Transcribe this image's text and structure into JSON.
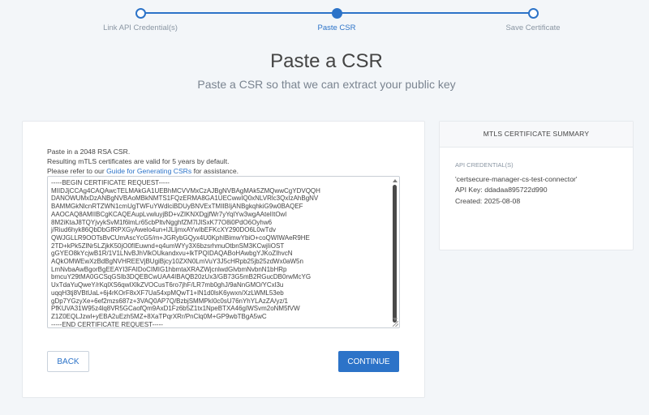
{
  "stepper": {
    "steps": [
      {
        "label": "Link API Credential(s)",
        "state": "complete"
      },
      {
        "label": "Paste CSR",
        "state": "active"
      },
      {
        "label": "Save Certificate",
        "state": "pending"
      }
    ]
  },
  "header": {
    "title": "Paste a CSR",
    "subtitle": "Paste a CSR so that we can extract your public key"
  },
  "form": {
    "line1": "Paste in a 2048 RSA CSR.",
    "line2": "Resulting mTLS certificates are valid for 5 years by default.",
    "line3_prefix": "Please refer to our ",
    "guide_link": "Guide for Generating CSRs",
    "line3_suffix": " for assistance.",
    "csr_value": "-----BEGIN CERTIFICATE REQUEST-----\nMIIDJjCCAg4CAQAwcTELMAkGA1UEBhMCVVMxCzAJBgNVBAgMAk5ZMQwwCgYDVQQH\nDANOWUMxDzANBgNVBAoMBkNMTS1FQzERMA8GA1UECwwIQ0xNLVRlc3QxIzAhBgNV\nBAMMGkNlcnRTZWN1cmUgTWFuYWdlciBDUyBNVExTMIIBIjANBgkqhkiG9w0BAQEF\nAAOCAQ8AMIIBCgKCAQEAupLvwluyjBD+vZIKNXDgjfWr7yYqIYw3wgAAteIItOwl\n8M2iKtaJ8TQYjvykSvM1f6lmLr65cbPltvNgghfZM7lJlSxK77O8i0PdO6Oyhw6\nj/Riud6hyk86QbDbGfRPXGyAwelo4un+lJLljmxAYwIbEFKcXY290DO6L0wTdv\nQWJGLLR9OOTsBvCUmAscYcG5/m+JGRybGQyx4U0KphIBimwYbiO+coQWIWAeR9HE\n2TD+kPk5ZlNr5LZjkK50jO0fIEuwnd+q4umWYy3X6bzsrhmuOtbnSM3KCwjIiOST\ngGYEO8kYcjwB1R/1V1LNvBJhVlkOUkandxvu+lkTPQIDAQABoHAwbgYJKoZIhvcN\nAQkOMWEwXzBdBgNVHREEVjBUgiBjcy10ZXN0LmVuY3J5cHRpb25jb25zdWx0aW5n\nLmNvbaAwBgorBgEEAYI3FAIDoCIMIG1hbmtaXRAZWjcnlwdGlvbmNvbnN1bHRp\nbmcuY29tMA0GCSqGSIb3DQEBCwUAA4IBAQB20zUx3/GB73G5mB2RGucDB0rwMcYG\nUxTdaYuQweY/rKqlXS6qwIXlkZVOCusT6ro7jhF/LR7mb0ghJ/9aNnGMO/YCxl3u\nuqqH3tj8VBtUaL+6j4rKOrF8xXF7Ua54xpMQwT1+lN1d0lsK6ywxn/XzLWML53eb\ngDp7YGzyXe+6ef2mzs687z+3VAQ0AP7Q/BzbjSMMPkI0c0sU76nYhYLAzZA/yz/1\nPfKUVA31W95z4lq8VR5GCaofQm9AxD1Fz6b5Z1tx1NpeBTXA46gIWSvm2oNM5fVW\nZ1Z0EQLJzwl+yEBA2uEzh5MZ+8XaTPqrXRr/PnClq0M+GP9wbTBgA5wC\n-----END CERTIFICATE REQUEST-----",
    "back_label": "BACK",
    "continue_label": "CONTINUE"
  },
  "summary": {
    "heading": "MTLS CERTIFICATE SUMMARY",
    "caption": "API CREDENTIAL(S)",
    "name": "'certsecure-manager-cs-test-connector'",
    "api_key_label": "API Key:",
    "api_key": "ddadaa895722d990",
    "created_label": "Created:",
    "created": "2025-08-08"
  },
  "colors": {
    "accent": "#2c73c8",
    "background": "#f3f6f9"
  }
}
